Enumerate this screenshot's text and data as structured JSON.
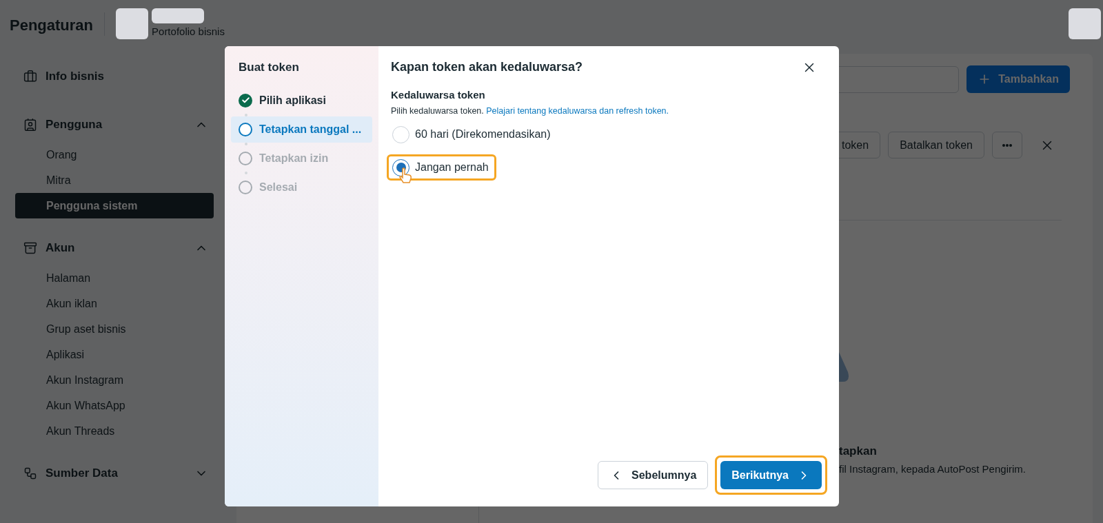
{
  "header": {
    "title": "Pengaturan",
    "portfolio_label": "Portofolio bisnis"
  },
  "sidebar": {
    "sections": [
      {
        "label": "Info bisnis"
      },
      {
        "label": "Pengguna",
        "expanded": true,
        "children": [
          {
            "label": "Orang",
            "selected": false
          },
          {
            "label": "Mitra",
            "selected": false
          },
          {
            "label": "Pengguna sistem",
            "selected": true
          }
        ]
      },
      {
        "label": "Akun",
        "expanded": true,
        "children": [
          {
            "label": "Halaman",
            "selected": false
          },
          {
            "label": "Akun iklan",
            "selected": false
          },
          {
            "label": "Grup aset bisnis",
            "selected": false
          },
          {
            "label": "Aplikasi",
            "selected": false
          },
          {
            "label": "Akun Instagram",
            "selected": false
          },
          {
            "label": "Akun WhatsApp",
            "selected": false
          },
          {
            "label": "Akun Threads",
            "selected": false
          }
        ]
      },
      {
        "label": "Sumber Data",
        "expanded": false
      }
    ]
  },
  "content": {
    "add_button": "Tambahkan",
    "actions": [
      "token",
      "Batalkan token"
    ],
    "empty_state": {
      "heading": "tapkan",
      "description": "fil Instagram, kepada AutoPost Pengirim."
    }
  },
  "dialog": {
    "sidebar_title": "Buat token",
    "steps": [
      {
        "label": "Pilih aplikasi",
        "kind": "done",
        "selected": false
      },
      {
        "label": "Tetapkan tanggal ...",
        "kind": "current",
        "selected": true
      },
      {
        "label": "Tetapkan izin",
        "kind": "pending",
        "selected": false
      },
      {
        "label": "Selesai",
        "kind": "pending",
        "selected": false
      }
    ],
    "title": "Kapan token akan kedaluwarsa?",
    "field_label": "Kedaluwarsa token",
    "help_text": "Pilih kedaluwarsa token.",
    "help_link": "Pelajari tentang kedaluwarsa dan refresh token.",
    "options": [
      {
        "label": "60 hari (Direkomendasikan)",
        "selected": false,
        "highlighted": false
      },
      {
        "label": "Jangan pernah",
        "selected": true,
        "highlighted": true
      }
    ],
    "back_button": {
      "label": "Sebelumnya",
      "highlighted": false
    },
    "next_button": {
      "label": "Berikutnya",
      "highlighted": true
    }
  }
}
